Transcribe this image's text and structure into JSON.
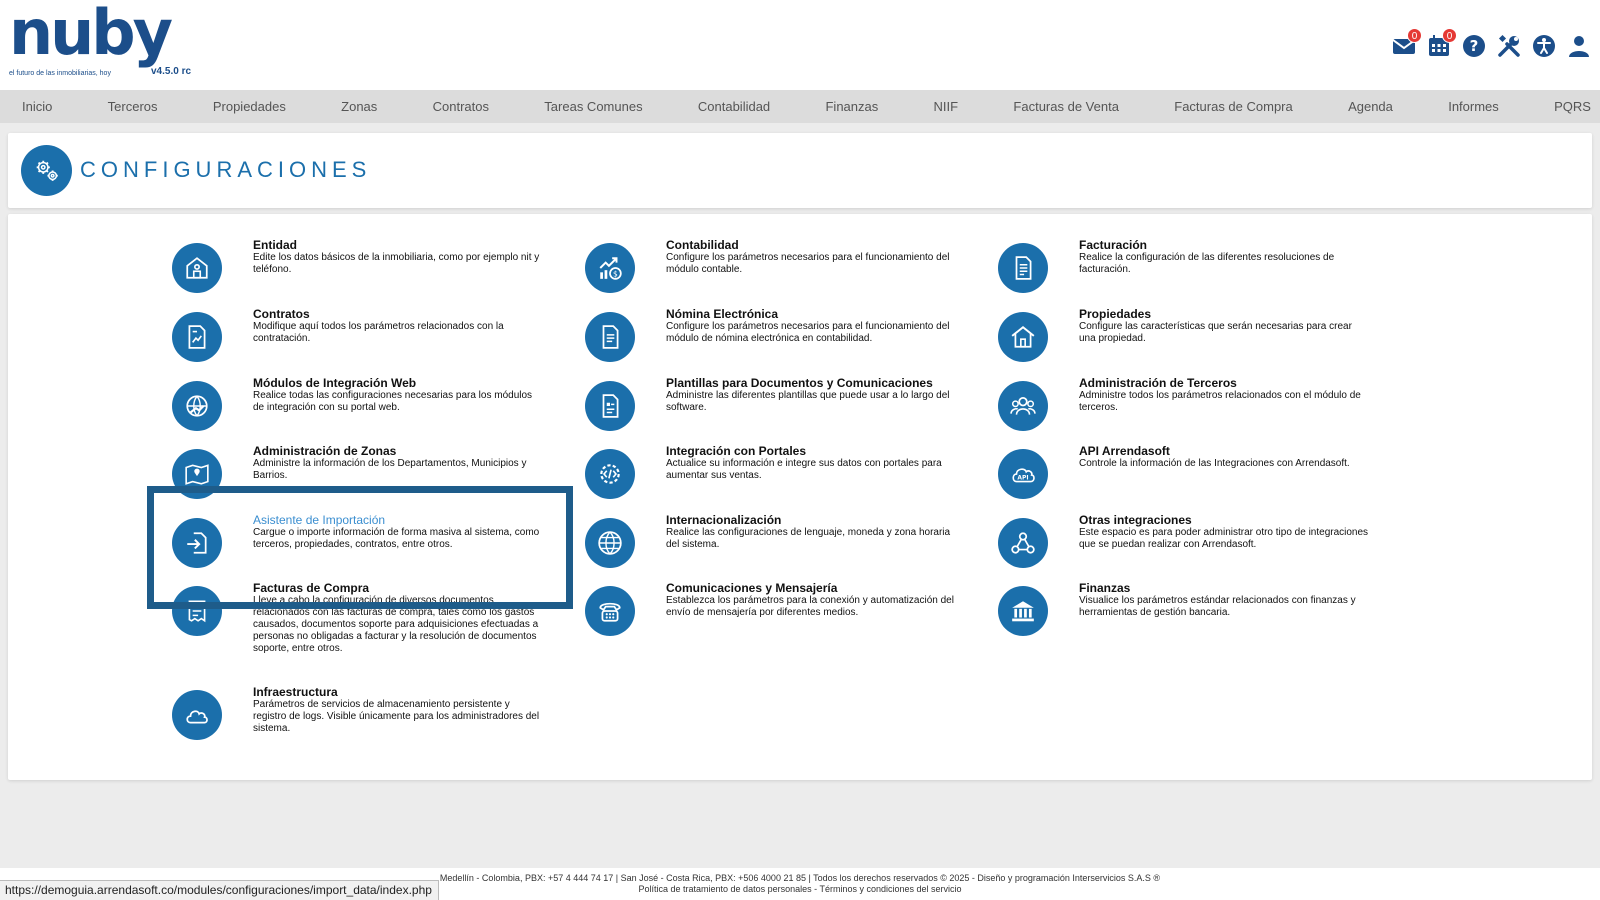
{
  "header": {
    "logo_text": "nuby",
    "tagline": "el futuro de las inmobiliarias, hoy",
    "version": "v4.5.0 rc",
    "icons": [
      {
        "name": "mail-icon",
        "badge": "0"
      },
      {
        "name": "calendar-icon",
        "badge": "0"
      },
      {
        "name": "help-icon"
      },
      {
        "name": "tools-icon"
      },
      {
        "name": "accessibility-icon"
      },
      {
        "name": "user-icon"
      }
    ]
  },
  "nav": {
    "items": [
      "Inicio",
      "Terceros",
      "Propiedades",
      "Zonas",
      "Contratos",
      "Tareas Comunes",
      "Contabilidad",
      "Finanzas",
      "NIIF",
      "Facturas de Venta",
      "Facturas de Compra",
      "Agenda",
      "Informes",
      "PQRS"
    ]
  },
  "page": {
    "title": "CONFIGURACIONES",
    "title_icon": "gears-icon"
  },
  "config": {
    "col1": [
      {
        "title": "Entidad",
        "desc": "Edite los datos básicos de la inmobiliaria, como por ejemplo nit y teléfono.",
        "icon": "building-icon"
      },
      {
        "title": "Contratos",
        "desc": "Modifique aquí todos los parámetros relacionados con la contratación.",
        "icon": "contract-icon"
      },
      {
        "title": "Módulos de Integración Web",
        "desc": "Realice todas las configuraciones necesarias para los módulos de integración con su portal web.",
        "icon": "globe-hand-icon"
      },
      {
        "title": "Administración de Zonas",
        "desc": "Administre la información de los Departamentos, Municipios y Barrios.",
        "icon": "map-icon"
      },
      {
        "title": "Asistente de Importación",
        "desc": "Cargue o importe información de forma masiva al sistema, como terceros, propiedades, contratos, entre otros.",
        "icon": "import-icon",
        "active": true
      },
      {
        "title": "Facturas de Compra",
        "desc": "Lleve a cabo la configuración de diversos documentos relacionados con las facturas de compra, tales como los gastos causados, documentos soporte para adquisiciones efectuadas a personas no obligadas a facturar y la resolución de documentos soporte, entre otros.",
        "icon": "invoice-icon"
      },
      {
        "title": "Infraestructura",
        "desc": "Parámetros de servicios de almacenamiento persistente y registro de logs. Visible únicamente para los administradores del sistema.",
        "icon": "cloud-icon"
      }
    ],
    "col2": [
      {
        "title": "Contabilidad",
        "desc": "Configure los parámetros necesarios para el funcionamiento del módulo contable.",
        "icon": "chart-money-icon"
      },
      {
        "title": "Nómina Electrónica",
        "desc": "Configure los parámetros necesarios para el funcionamiento del módulo de nómina electrónica en contabilidad.",
        "icon": "payroll-icon"
      },
      {
        "title": "Plantillas para Documentos y Comunicaciones",
        "desc": "Administre las diferentes plantillas que puede usar a lo largo del software.",
        "icon": "template-icon"
      },
      {
        "title": "Integración con Portales",
        "desc": "Actualice su información e integre sus datos con portales para aumentar sus ventas.",
        "icon": "code-gear-icon"
      },
      {
        "title": "Internacionalización",
        "desc": "Realice las configuraciones de lenguaje, moneda y zona horaria del sistema.",
        "icon": "globe-icon"
      },
      {
        "title": "Comunicaciones y Mensajería",
        "desc": "Establezca los parámetros para la conexión y automatización del envío de mensajería por diferentes medios.",
        "icon": "phone-icon"
      }
    ],
    "col3": [
      {
        "title": "Facturación",
        "desc": "Realice la configuración de las diferentes resoluciones de facturación.",
        "icon": "document-icon"
      },
      {
        "title": "Propiedades",
        "desc": "Configure las características que serán necesarias para crear una propiedad.",
        "icon": "house-icon"
      },
      {
        "title": "Administración de Terceros",
        "desc": "Administre todos los parámetros relacionados con el módulo de terceros.",
        "icon": "users-icon"
      },
      {
        "title": "API Arrendasoft",
        "desc": "Controle la información de las Integraciones con Arrendasoft.",
        "icon": "api-cloud-icon"
      },
      {
        "title": "Otras integraciones",
        "desc": "Este espacio es para poder administrar otro tipo de integraciones que se puedan realizar con Arrendasoft.",
        "icon": "webhook-icon"
      },
      {
        "title": "Finanzas",
        "desc": "Visualice los parámetros estándar relacionados con finanzas y herramientas de gestión bancaria.",
        "icon": "bank-icon"
      }
    ]
  },
  "footer": {
    "line1": "Medellín - Colombia, PBX: +57 4 444 74 17 | San José - Costa Rica, PBX: +506 4000 21 85 | Todos los derechos reservados © 2025 - Diseño y programación Interservicios S.A.S ®",
    "line2": "Política de tratamiento de datos personales - Términos y condiciones del servicio"
  },
  "status_url": "https://demoguia.arrendasoft.co/modules/configuraciones/import_data/index.php",
  "colors": {
    "primary": "#1b6fab",
    "brand": "#1c4e8a",
    "badge": "#e53935",
    "highlight": "#1e5c8a",
    "active_link": "#3a8ed0"
  }
}
